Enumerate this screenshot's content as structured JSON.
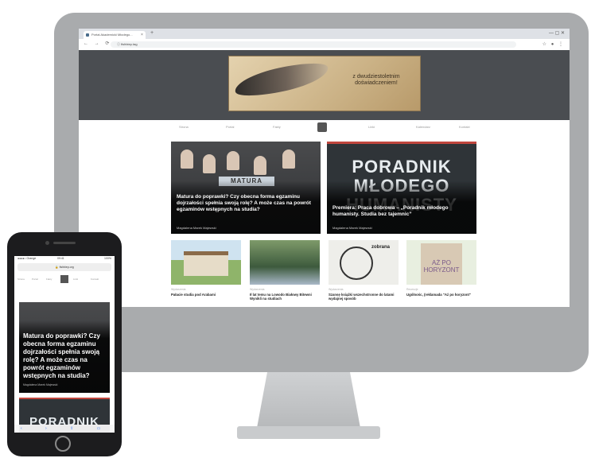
{
  "browser": {
    "tab_title": "Portal Akademicki Młodego...",
    "tab_close": "×",
    "new_tab": "+",
    "window_controls": "— ▢ ✕",
    "nav_icons": "← → ⟳",
    "url": "ⓘ fishbiep.tag",
    "ext_icons": "☆ ● ⋮"
  },
  "site": {
    "banner_text": "z dwudziestoletnim doświadczeniem!",
    "nav": [
      "Strona",
      "Portal",
      "Fakty",
      "Linki",
      "Kalendarz",
      "Kontakt"
    ],
    "featured": [
      {
        "image_text": "MATURA",
        "title": "Matura do poprawki? Czy obecna forma egzaminu dojrzałości spełnia swoją rolę? A może czas na powrót egzaminów wstępnych na studia?",
        "author": "Magdalena Marek Majewski"
      },
      {
        "image_text": "PORADNIK MŁODEGO HUMANISTY",
        "title": "Premiera: Praca dobrowa – „Poradnik młodego humanisty. Studia bez tajemnic”",
        "author": "Magdalena Marek Majewski"
      }
    ],
    "articles": [
      {
        "category": "Wydarzenia",
        "title": "Pałacie studia pod Arabami"
      },
      {
        "category": "Wydarzenia",
        "title": "Ił lat temu na Lowodo Białowy Bitewni Wynikli na studiach"
      },
      {
        "category": "Wydarzenia",
        "title": "Szansę książki wszechstronne do latami wydajnej sposób",
        "image_text": "zobrana"
      },
      {
        "category": "Recenzje",
        "title": "Ugólnośc, (reklamada \"Aż po horyzont\"",
        "image_text": "AŻ PO HORYZONT"
      }
    ]
  },
  "phone": {
    "status_left": "●●●●○ Orange",
    "status_time": "09:41",
    "status_right": "100%",
    "url": "🔒 fishbiep.org",
    "nav": [
      "Strona",
      "Portal",
      "Fakty",
      "Linki",
      "Kontakt"
    ],
    "card_title": "Matura do poprawki? Czy obecna forma egzaminu dojrzałości spełnia swoją rolę? A może czas na powrót egzaminów wstępnych na studia?",
    "card_author": "Magdalena Marek Majewski",
    "second_card_text": "PORADNIK",
    "toolbar": "‹ › ⇪ ▭ ⧉"
  }
}
